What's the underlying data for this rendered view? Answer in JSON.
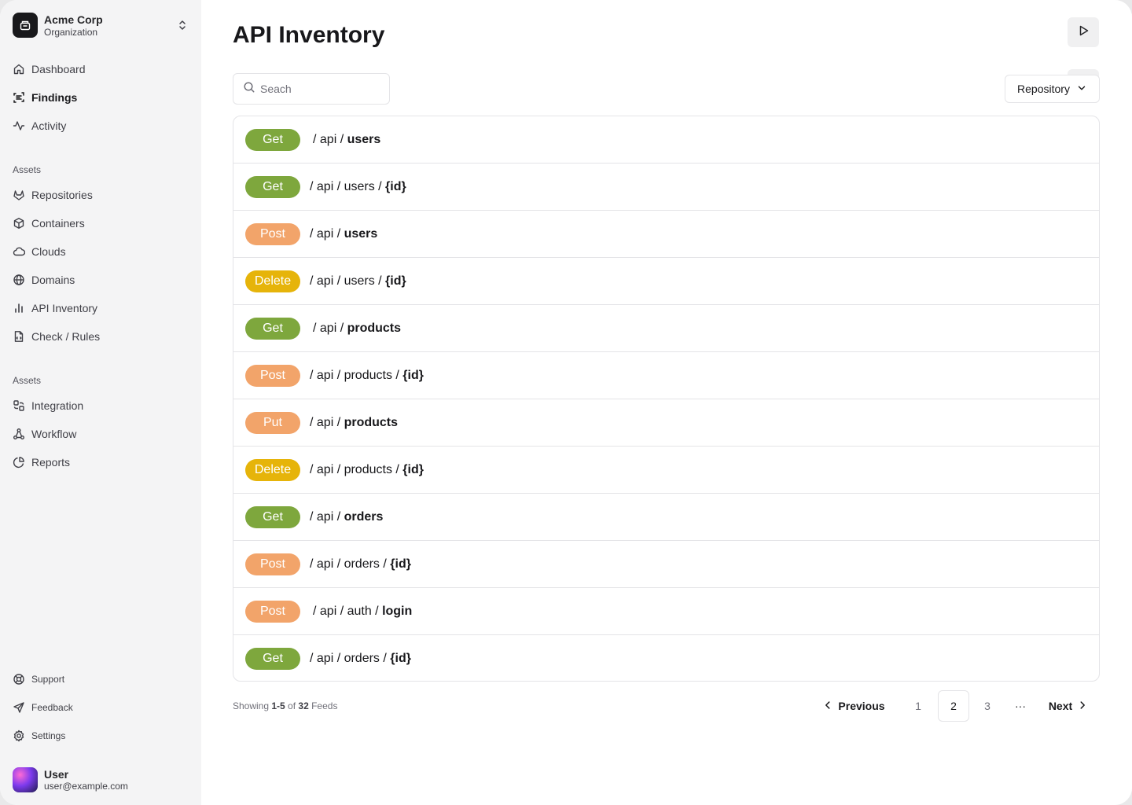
{
  "org": {
    "name": "Acme Corp",
    "subtitle": "Organization"
  },
  "nav": {
    "main": [
      {
        "label": "Dashboard",
        "icon": "home-icon"
      },
      {
        "label": "Findings",
        "icon": "scan-icon",
        "active": true
      },
      {
        "label": "Activity",
        "icon": "activity-icon"
      }
    ],
    "assets_label": "Assets",
    "assets": [
      {
        "label": "Repositories",
        "icon": "gitlab-icon"
      },
      {
        "label": "Containers",
        "icon": "box-icon"
      },
      {
        "label": "Clouds",
        "icon": "cloud-icon"
      },
      {
        "label": "Domains",
        "icon": "globe-icon"
      },
      {
        "label": "API Inventory",
        "icon": "bar-chart-icon"
      },
      {
        "label": "Check / Rules",
        "icon": "file-code-icon"
      }
    ],
    "assets2_label": "Assets",
    "assets2": [
      {
        "label": "Integration",
        "icon": "integration-icon"
      },
      {
        "label": "Workflow",
        "icon": "workflow-icon"
      },
      {
        "label": "Reports",
        "icon": "pie-chart-icon"
      }
    ],
    "bottom": [
      {
        "label": "Support",
        "icon": "life-buoy-icon"
      },
      {
        "label": "Feedback",
        "icon": "send-icon"
      },
      {
        "label": "Settings",
        "icon": "gear-icon"
      }
    ]
  },
  "user": {
    "name": "User",
    "email": "user@example.com"
  },
  "page": {
    "title": "API Inventory"
  },
  "search": {
    "placeholder": "Seach"
  },
  "filter": {
    "label": "Repository"
  },
  "endpoints": [
    {
      "method": "Get",
      "prefix": "/ api / ",
      "last": "users"
    },
    {
      "method": "Get",
      "prefix": "/ api / users / ",
      "last": "{id}"
    },
    {
      "method": "Post",
      "prefix": "/ api / ",
      "last": "users"
    },
    {
      "method": "Delete",
      "prefix": "/ api / users / ",
      "last": "{id}"
    },
    {
      "method": "Get",
      "prefix": "/ api / ",
      "last": "products"
    },
    {
      "method": "Post",
      "prefix": "/ api / products / ",
      "last": "{id}"
    },
    {
      "method": "Put",
      "prefix": "/ api / ",
      "last": "products"
    },
    {
      "method": "Delete",
      "prefix": "/ api / products / ",
      "last": "{id}"
    },
    {
      "method": "Get",
      "prefix": "/ api / ",
      "last": "orders"
    },
    {
      "method": "Post",
      "prefix": "/ api / orders / ",
      "last": "{id}"
    },
    {
      "method": "Post",
      "prefix": "/ api / auth / ",
      "last": "login"
    },
    {
      "method": "Get",
      "prefix": "/ api / orders / ",
      "last": "{id}"
    }
  ],
  "footer": {
    "showing_prefix": "Showing ",
    "range": "1-5",
    "of_text": " of ",
    "total": "32",
    "suffix": " Feeds"
  },
  "pagination": {
    "previous": "Previous",
    "pages": [
      "1",
      "2",
      "3"
    ],
    "current": "2",
    "ellipsis": "···",
    "next": "Next"
  },
  "colors": {
    "get": "#7ea73d",
    "post": "#f2a46a",
    "put": "#f2a46a",
    "delete": "#e6b40a",
    "sidebar_bg": "#f4f4f5"
  }
}
